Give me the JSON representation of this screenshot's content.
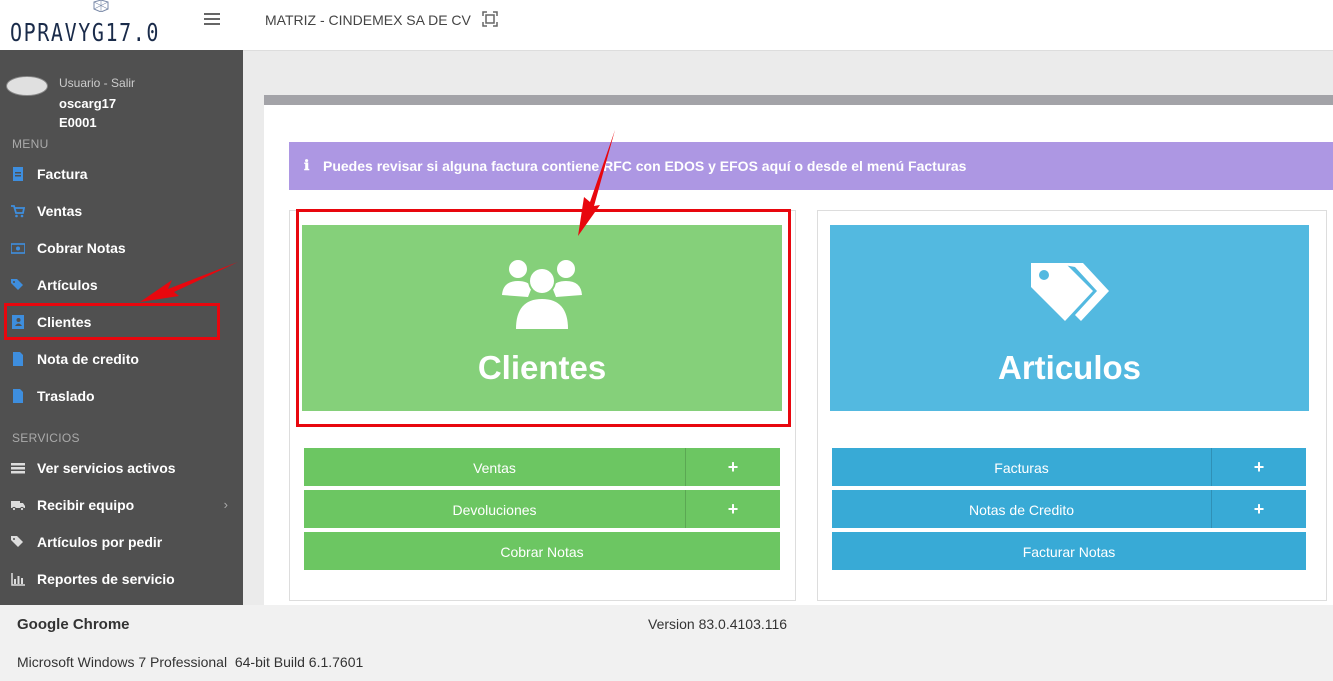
{
  "app": {
    "logo_text": "OPRAVYG17.0",
    "company": "MATRIZ - CINDEMEX SA DE CV"
  },
  "user": {
    "link": "Usuario - Salir",
    "name": "oscarg17",
    "code": "E0001"
  },
  "sidebar": {
    "menu_label": "MENU",
    "items": [
      {
        "label": "Factura",
        "icon": "invoice-icon"
      },
      {
        "label": "Ventas",
        "icon": "cart-icon"
      },
      {
        "label": "Cobrar Notas",
        "icon": "money-icon"
      },
      {
        "label": "Artículos",
        "icon": "tags-icon"
      },
      {
        "label": "Clientes",
        "icon": "address-book-icon"
      },
      {
        "label": "Nota de credito",
        "icon": "document-icon"
      },
      {
        "label": "Traslado",
        "icon": "document-icon"
      }
    ],
    "services_label": "SERVICIOS",
    "service_items": [
      {
        "label": "Ver servicios activos",
        "icon": "list-icon"
      },
      {
        "label": "Recibir equipo",
        "icon": "truck-icon",
        "chevron": "›"
      },
      {
        "label": "Artículos por pedir",
        "icon": "tags-icon"
      },
      {
        "label": "Reportes de servicio",
        "icon": "bar-chart-icon"
      }
    ]
  },
  "alert": {
    "icon": "info-icon",
    "text": "Puedes revisar si alguna factura contiene RFC con EDOS y EFOS aquí o desde el menú Facturas"
  },
  "clientes_card": {
    "title": "Clientes",
    "icon": "users-icon",
    "color": "#85d07a",
    "buttons": [
      {
        "label": "Ventas",
        "plus": "+"
      },
      {
        "label": "Devoluciones",
        "plus": "+"
      },
      {
        "label": "Cobrar Notas"
      }
    ]
  },
  "articulos_card": {
    "title": "Articulos",
    "icon": "tags-icon",
    "color": "#53b9e0",
    "buttons": [
      {
        "label": "Facturas",
        "plus": "+"
      },
      {
        "label": "Notas de Credito",
        "plus": "+"
      },
      {
        "label": "Facturar Notas"
      }
    ]
  },
  "footer": {
    "browser": "Google Chrome",
    "version": "Version 83.0.4103.116",
    "os": "Microsoft Windows 7 Professional  64-bit Build 6.1.7601"
  },
  "colors": {
    "sidebar": "#505050",
    "alert": "#ad97e3",
    "green_button": "#6cc662",
    "blue_button": "#38aad6",
    "annotation_red": "#e8070e"
  }
}
